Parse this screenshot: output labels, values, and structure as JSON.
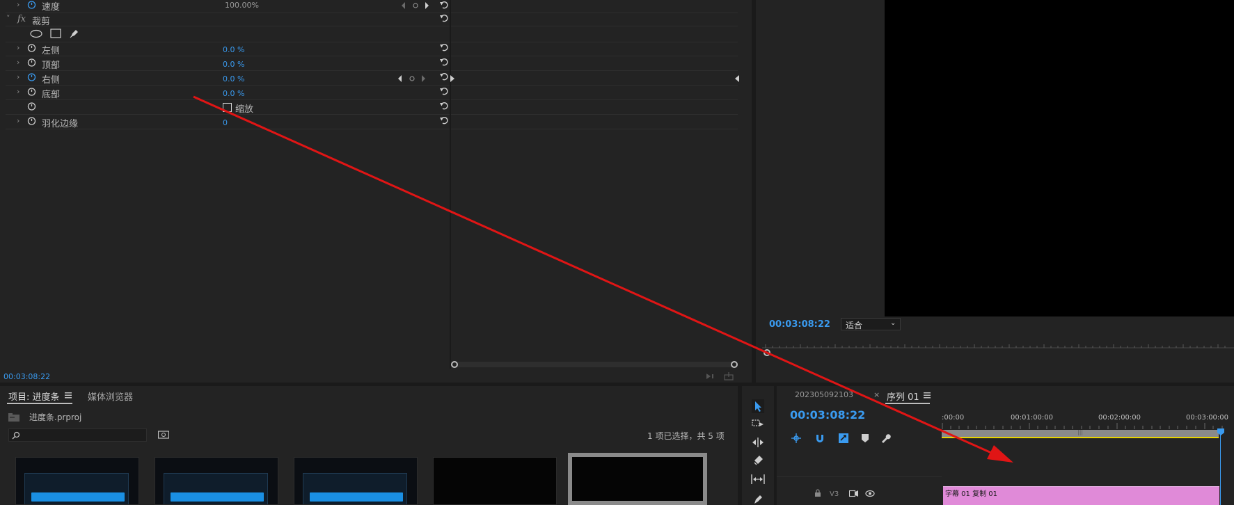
{
  "effect_controls": {
    "speed": {
      "label": "速度",
      "value": "100.00%"
    },
    "crop_section": {
      "fx_label": "fx",
      "label": "裁剪"
    },
    "properties": [
      {
        "label": "左侧",
        "value": "0.0",
        "unit": "%"
      },
      {
        "label": "顶部",
        "value": "0.0",
        "unit": "%"
      },
      {
        "label": "右侧",
        "value": "0.0",
        "unit": "%"
      },
      {
        "label": "底部",
        "value": "0.0",
        "unit": "%"
      }
    ],
    "zoom_checkbox_label": "缩放",
    "feather": {
      "label": "羽化边缘",
      "value": "0"
    },
    "timecode": "00:03:08:22"
  },
  "program_monitor": {
    "timecode": "00:03:08:22",
    "fit_select": "适合"
  },
  "project_panel": {
    "tab_project": "项目: 进度条",
    "tab_media_browser": "媒体浏览器",
    "project_file": "进度条.prproj",
    "search_placeholder": "",
    "selection_status": "1 项已选择，共 5 项"
  },
  "timeline": {
    "tab_inactive": "202305092103",
    "tab_close": "×",
    "tab_active": "序列 01",
    "timecode": "00:03:08:22",
    "ruler_labels": [
      ":00:00",
      "00:01:00:00",
      "00:02:00:00",
      "00:03:00:00"
    ],
    "track_name": "V3",
    "clip_label": "字幕 01 复制 01"
  },
  "colors": {
    "accent_blue": "#3a9bf0",
    "clip_pink": "#e08ad8",
    "arrow_red": "#e01515",
    "work_area_yellow": "#e8d400"
  }
}
